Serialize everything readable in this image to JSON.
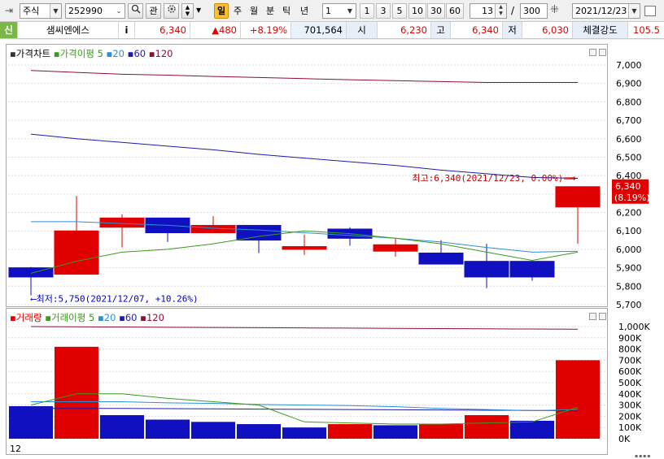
{
  "toolbar": {
    "market_type": "주식",
    "stock_code": "252990",
    "btn_gwan": "관",
    "period_tabs": [
      "일",
      "주",
      "월",
      "분",
      "틱",
      "년"
    ],
    "selected_period": "일",
    "interval_value": "1",
    "interval_buttons": [
      "1",
      "3",
      "5",
      "10",
      "30",
      "60"
    ],
    "count_value": "13",
    "count_sep": "/",
    "count_total": "300",
    "date_value": "2021/12/23"
  },
  "infobar": {
    "sin_label": "신",
    "stock_name": "샘씨엔에스",
    "info_icon": "i",
    "price": "6,340",
    "change": "▲480",
    "change_pct": "+8.19%",
    "volume": "701,564",
    "open_label": "시",
    "open": "6,230",
    "high_label": "고",
    "high": "6,340",
    "low_label": "저",
    "low": "6,030",
    "strength_label": "체결강도",
    "strength": "105.5"
  },
  "price_panel": {
    "title": "가격차트",
    "ma_label": "가격이평",
    "ma_periods": [
      "5",
      "20",
      "60",
      "120"
    ],
    "ma_colors": [
      "#3a9a1e",
      "#2d8fd6",
      "#1c1ca8",
      "#8a1030"
    ],
    "y_ticks": [
      "7,000",
      "6,900",
      "6,800",
      "6,700",
      "6,600",
      "6,500",
      "6,400",
      "6,300",
      "6,200",
      "6,100",
      "6,000",
      "5,900",
      "5,800",
      "5,700"
    ],
    "high_annotation": "최고:6,340(2021/12/23, 0.00%)⟹",
    "low_annotation": "⟵최저:5,750(2021/12/07, +10.26%)",
    "last_price_tag": "6,340",
    "last_pct_tag": "(8.19%)"
  },
  "volume_panel": {
    "title": "거래량",
    "ma_label": "거래이평",
    "ma_periods": [
      "5",
      "20",
      "60",
      "120"
    ],
    "y_ticks": [
      "1,000K",
      "900K",
      "800K",
      "700K",
      "600K",
      "500K",
      "400K",
      "300K",
      "200K",
      "100K",
      "0K"
    ],
    "footer_count": "12"
  },
  "chart_data": {
    "type": "candlestick",
    "candles": [
      {
        "o": 5900,
        "h": 5905,
        "l": 5750,
        "c": 5850,
        "up": false
      },
      {
        "o": 5865,
        "h": 6290,
        "l": 5865,
        "c": 6100,
        "up": true
      },
      {
        "o": 6120,
        "h": 6190,
        "l": 6010,
        "c": 6170,
        "up": true
      },
      {
        "o": 6170,
        "h": 6170,
        "l": 6040,
        "c": 6090,
        "up": false
      },
      {
        "o": 6090,
        "h": 6180,
        "l": 6090,
        "c": 6130,
        "up": true
      },
      {
        "o": 6130,
        "h": 6130,
        "l": 5980,
        "c": 6050,
        "up": false
      },
      {
        "o": 6000,
        "h": 6080,
        "l": 5970,
        "c": 6015,
        "up": true
      },
      {
        "o": 6110,
        "h": 6120,
        "l": 6020,
        "c": 6060,
        "up": false
      },
      {
        "o": 5990,
        "h": 6060,
        "l": 5960,
        "c": 6025,
        "up": true
      },
      {
        "o": 5980,
        "h": 6050,
        "l": 5920,
        "c": 5920,
        "up": false
      },
      {
        "o": 5935,
        "h": 6030,
        "l": 5790,
        "c": 5850,
        "up": false
      },
      {
        "o": 5935,
        "h": 5935,
        "l": 5830,
        "c": 5850,
        "up": false
      },
      {
        "o": 6230,
        "h": 6340,
        "l": 6030,
        "c": 6340,
        "up": true
      }
    ],
    "ma5": [
      5870,
      5935,
      5985,
      6000,
      6030,
      6070,
      6100,
      6085,
      6060,
      6030,
      5985,
      5940,
      5985
    ],
    "ma20": [
      6150,
      6150,
      6140,
      6130,
      6115,
      6105,
      6090,
      6075,
      6060,
      6040,
      6010,
      5985,
      5990
    ],
    "ma60": [
      6625,
      6600,
      6580,
      6560,
      6540,
      6515,
      6495,
      6475,
      6455,
      6430,
      6410,
      6390,
      6385
    ],
    "ma120": [
      6970,
      6960,
      6950,
      6945,
      6938,
      6932,
      6926,
      6920,
      6915,
      6910,
      6905,
      6905,
      6905
    ],
    "price_ylim": [
      5700,
      7000
    ],
    "volumes": [
      290000,
      820000,
      210000,
      170000,
      150000,
      130000,
      100000,
      130000,
      120000,
      130000,
      210000,
      160000,
      700000
    ],
    "volume_up": [
      false,
      true,
      false,
      false,
      false,
      false,
      false,
      true,
      false,
      true,
      true,
      false,
      true
    ],
    "vol_ma5": [
      300000,
      400000,
      400000,
      360000,
      330000,
      300000,
      150000,
      140000,
      130000,
      130000,
      140000,
      150000,
      280000
    ],
    "vol_ma20": [
      330000,
      330000,
      330000,
      320000,
      315000,
      305000,
      300000,
      295000,
      285000,
      270000,
      260000,
      250000,
      260000
    ],
    "vol_ma60": [
      270000,
      270000,
      270000,
      268000,
      266000,
      264000,
      262000,
      260000,
      258000,
      256000,
      254000,
      252000,
      250000
    ],
    "vol_ma120": [
      1000000,
      998000,
      996000,
      994000,
      992000,
      990000,
      988000,
      986000,
      984000,
      982000,
      980000,
      978000,
      976000
    ],
    "volume_ylim": [
      0,
      1000000
    ]
  }
}
